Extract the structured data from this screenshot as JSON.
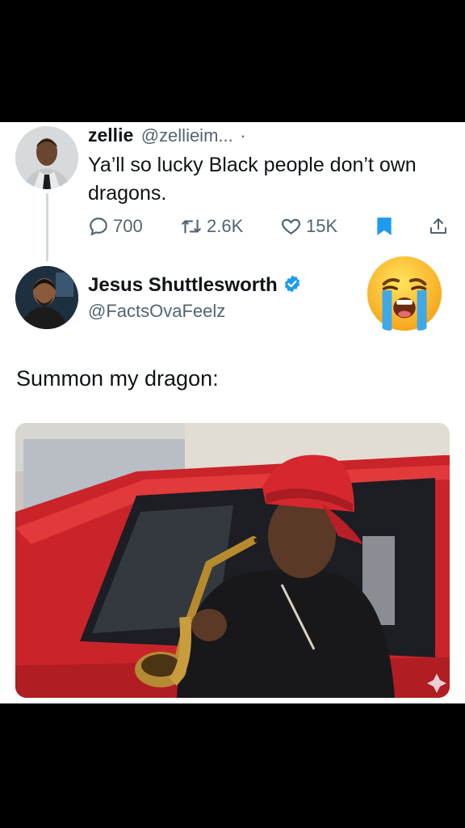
{
  "reply_tweet": {
    "author_name": "zellie",
    "author_handle": "@zellieim...",
    "separator": "·",
    "text": "Ya’ll so lucky Black people don’t own dragons.",
    "stats": {
      "replies": "700",
      "retweets": "2.6K",
      "likes": "15K"
    }
  },
  "main_tweet": {
    "author_name": "Jesus Shuttlesworth",
    "author_handle": "@FactsOvaFeelz",
    "verified": true,
    "reaction_emoji": "loudly-crying-face-icon",
    "text": "Summon my dragon:",
    "media": "photo: young man in red cap playing saxophone leaning out of a red car window"
  },
  "colors": {
    "text_primary": "#0f1419",
    "text_secondary": "#536471",
    "bookmark_blue": "#1d9bf0",
    "verified_blue": "#1d9bf0",
    "background": "#000000",
    "card": "#ffffff"
  }
}
